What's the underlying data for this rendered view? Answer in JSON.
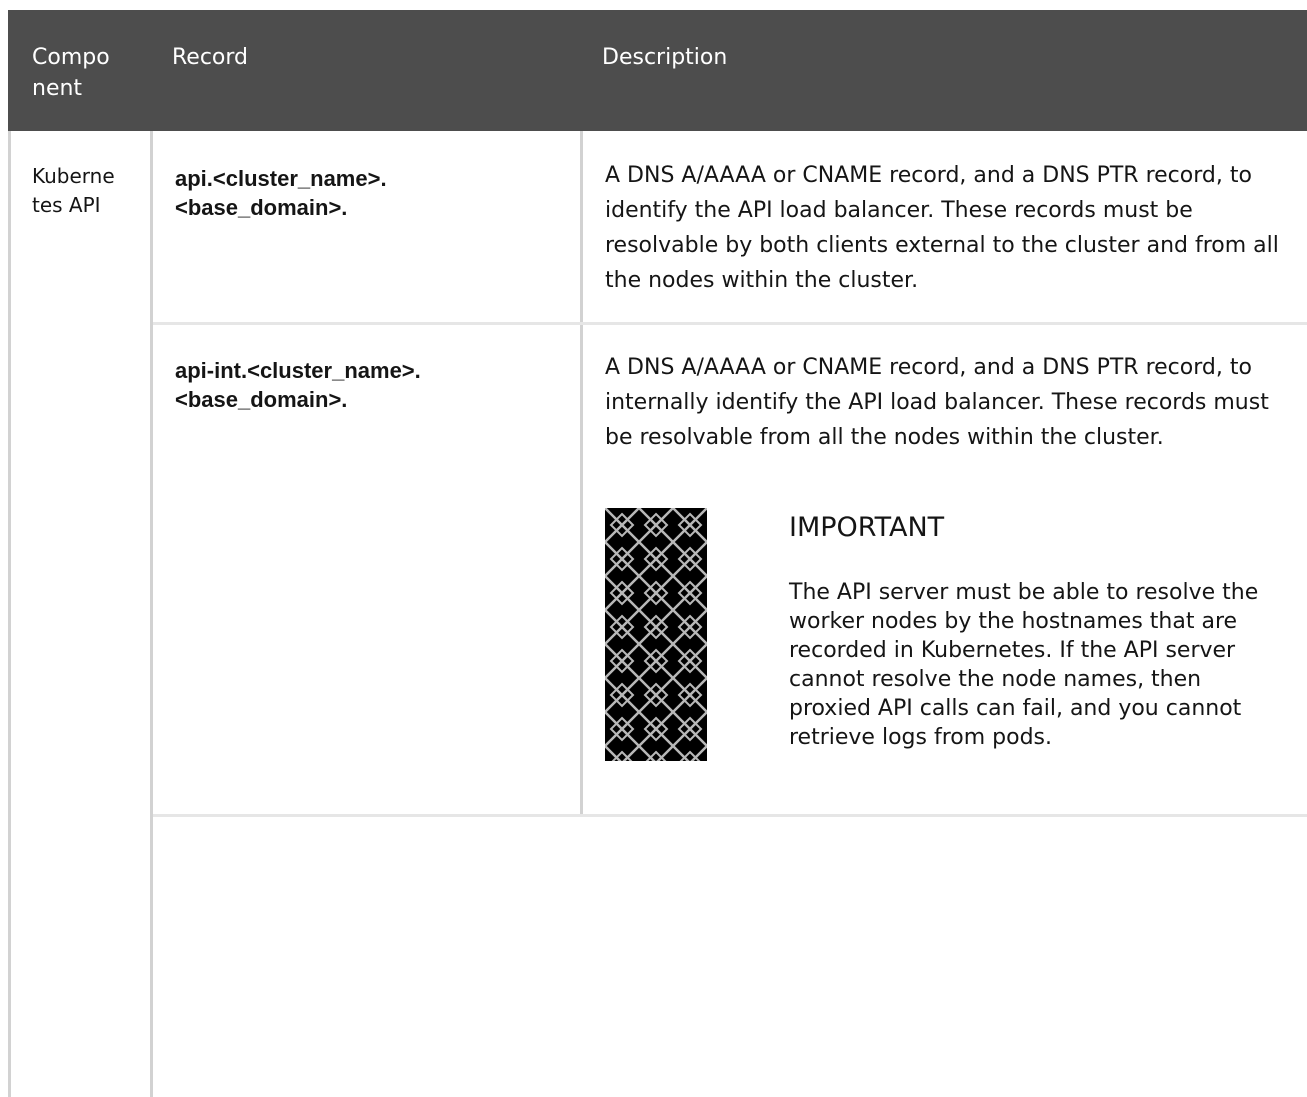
{
  "table": {
    "headers": {
      "component": "Compo nent",
      "record": "Record",
      "description": "Description"
    },
    "rows": [
      {
        "component": "Kuberne tes API",
        "record_line1": "api.<cluster_name>.",
        "record_line2": "<base_domain>.",
        "description": "A DNS A/AAAA or CNAME record, and a DNS PTR record, to identify the API load balancer. These records must be resolvable by both clients external to the cluster and from all the nodes within the cluster."
      },
      {
        "record_line1": "api-int.<cluster_name>.",
        "record_line2": "<base_domain>.",
        "description": "A DNS A/AAAA or CNAME record, and a DNS PTR record, to internally identify the API load balancer. These records must be resolvable from all the nodes within the cluster.",
        "admonition": {
          "title": "IMPORTANT",
          "body": "The API server must be able to resolve the worker nodes by the hostnames that are recorded in Kubernetes. If the API server cannot resolve the node names, then proxied API calls can fail, and you cannot retrieve logs from pods.",
          "icon": "important-pattern-icon"
        }
      }
    ]
  },
  "colors": {
    "header_bg": "#4d4d4d",
    "header_text": "#ffffff",
    "border": "#d2d2d2"
  }
}
